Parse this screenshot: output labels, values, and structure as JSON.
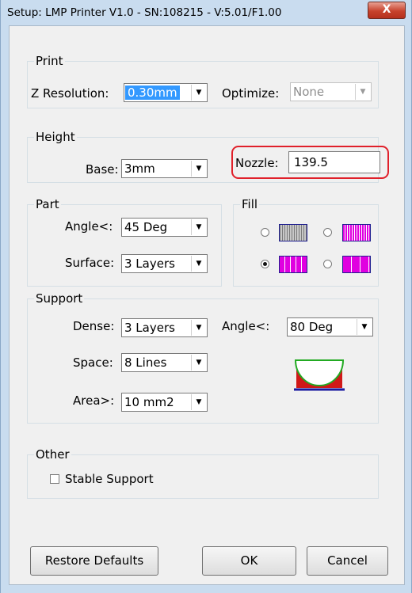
{
  "window": {
    "title": "Setup: LMP Printer V1.0 - SN:108215 - V:5.01/F1.00",
    "close_glyph": "X"
  },
  "print": {
    "legend": "Print",
    "z_resolution": {
      "label": "Z Resolution:",
      "value": "0.30mm"
    },
    "optimize": {
      "label": "Optimize:",
      "value": "None"
    }
  },
  "height": {
    "legend": "Height",
    "base": {
      "label": "Base:",
      "value": "3mm"
    },
    "nozzle": {
      "label": "Nozzle:",
      "value": "139.5"
    }
  },
  "part": {
    "legend": "Part",
    "angle": {
      "label": "Angle<:",
      "value": "45 Deg"
    },
    "surface": {
      "label": "Surface:",
      "value": "3 Layers"
    }
  },
  "fill": {
    "legend": "Fill",
    "options": [
      {
        "pattern": "gray-vertical-lines",
        "selected": false
      },
      {
        "pattern": "magenta-dense-lines",
        "selected": false
      },
      {
        "pattern": "magenta-medium-lines",
        "selected": true
      },
      {
        "pattern": "magenta-sparse-lines",
        "selected": false
      }
    ]
  },
  "support": {
    "legend": "Support",
    "dense": {
      "label": "Dense:",
      "value": "3 Layers"
    },
    "space": {
      "label": "Space:",
      "value": "8 Lines"
    },
    "area": {
      "label": "Area>:",
      "value": "10 mm2"
    },
    "angle": {
      "label": "Angle<:",
      "value": "80 Deg"
    },
    "preview_icon": "support-preview-icon"
  },
  "other": {
    "legend": "Other",
    "stable_support": {
      "label": "Stable Support",
      "checked": false
    }
  },
  "buttons": {
    "restore": "Restore Defaults",
    "ok": "OK",
    "cancel": "Cancel"
  },
  "icons": {
    "dropdown": "chevron-down-icon",
    "close": "close-icon"
  },
  "colors": {
    "highlight": "#e0202a",
    "selection": "#3399ff",
    "fill_magenta": "#e000e0",
    "close_button": "#c7432d"
  }
}
